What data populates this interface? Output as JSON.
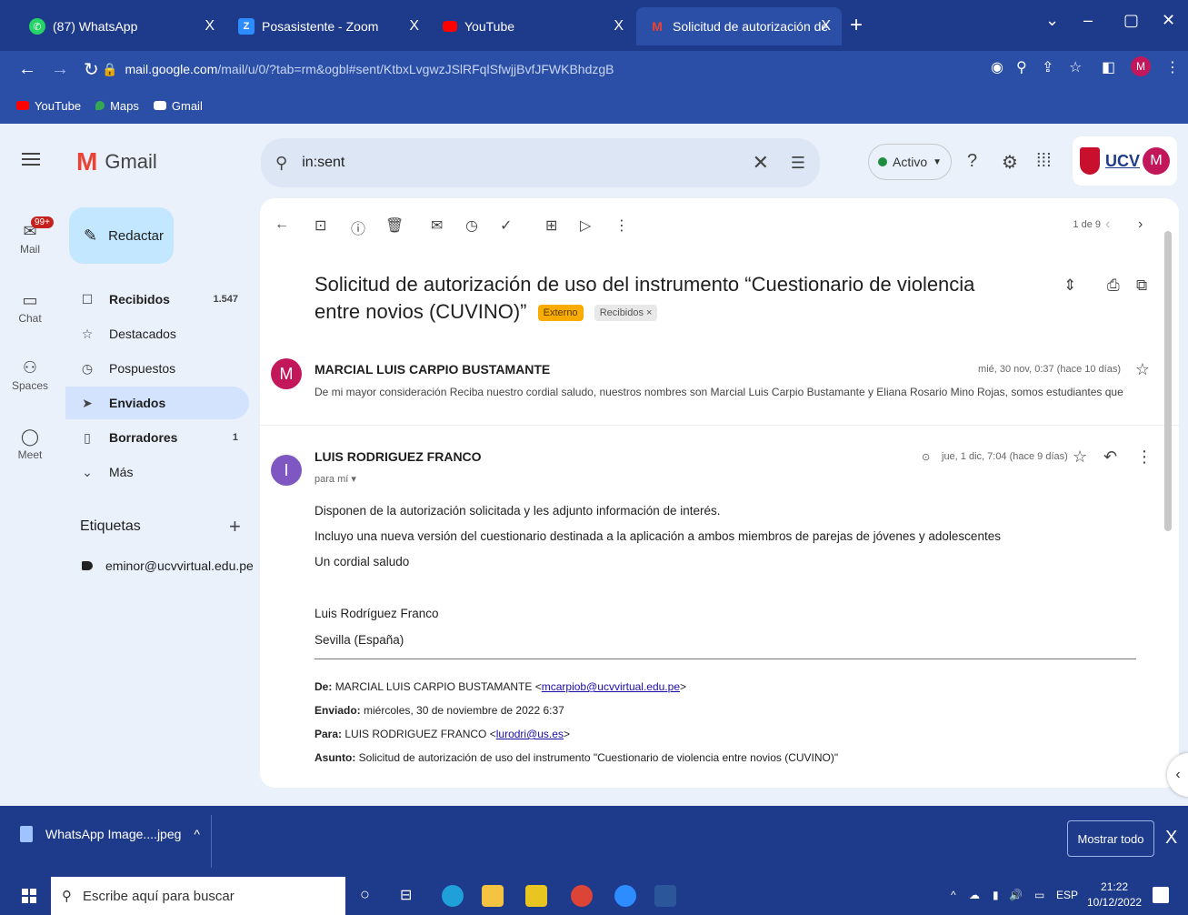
{
  "browser": {
    "tabs": [
      {
        "label": "(87) WhatsApp",
        "icon": "whatsapp-icon",
        "close": "X"
      },
      {
        "label": "Posasistente - Zoom",
        "icon": "zoom-icon",
        "close": "X"
      },
      {
        "label": "YouTube",
        "icon": "youtube-icon",
        "close": "X"
      },
      {
        "label": "Solicitud de autorización de uso",
        "icon": "gmail-icon",
        "close": "X"
      }
    ],
    "new_tab": "+",
    "url_host": "mail.google.com",
    "url_path": "/mail/u/0/?tab=rm&ogbl#sent/KtbxLvgwzJSlRFqlSfwjjBvfJFWKBhdzgB",
    "profile_initial": "M",
    "bookmarks": [
      "YouTube",
      "Maps",
      "Gmail"
    ]
  },
  "gmail": {
    "logo_text": "Gmail",
    "search_value": "in:sent",
    "status": "Activo",
    "ucv_logo": "UCV",
    "avatar_initial": "M"
  },
  "rail": {
    "mail": "Mail",
    "mail_badge": "99+",
    "chat": "Chat",
    "spaces": "Spaces",
    "meet": "Meet"
  },
  "nav": {
    "compose": "Redactar",
    "items": [
      {
        "label": "Recibidos",
        "count": "1.547"
      },
      {
        "label": "Destacados",
        "count": ""
      },
      {
        "label": "Pospuestos",
        "count": ""
      },
      {
        "label": "Enviados",
        "count": ""
      },
      {
        "label": "Borradores",
        "count": "1"
      },
      {
        "label": "Más",
        "count": ""
      }
    ],
    "labels_header": "Etiquetas",
    "labels_add": "+",
    "label_items": [
      "eminor@ucvvirtual.edu.pe"
    ]
  },
  "thread": {
    "pager": "1 de 9",
    "subject": "Solicitud de autorización de uso del instrumento “Cuestionario de violencia entre novios (CUVINO)”",
    "chip_external": "Externo",
    "chip_inbox": "Recibidos ×",
    "message1": {
      "avatar": "M",
      "sender": "MARCIAL LUIS CARPIO BUSTAMANTE",
      "date": "mié, 30 nov, 0:37 (hace 10 días)",
      "snippet": "De mi mayor consideración Reciba nuestro cordial saludo, nuestros nombres son Marcial Luis Carpio Bustamante y Eliana Rosario Mino Rojas, somos estudiantes que"
    },
    "message2": {
      "avatar": "I",
      "sender": "LUIS RODRIGUEZ FRANCO",
      "to": "para mí ▾",
      "date": "jue, 1 dic, 7:04 (hace 9 días)",
      "body": [
        "Disponen de la autorización solicitada y les adjunto información de interés.",
        "Incluyo una nueva versión del cuestionario destinada a la aplicación a ambos miembros de parejas de jóvenes y adolescentes",
        "Un cordial saludo",
        "Luis Rodríguez Franco",
        "Sevilla (España)"
      ],
      "quote": {
        "from_label": "De:",
        "from_value": "MARCIAL LUIS CARPIO BUSTAMANTE <",
        "from_email": "mcarpiob@ucvvirtual.edu.pe",
        "sent_label": "Enviado:",
        "sent_value": "miércoles, 30 de noviembre de 2022 6:37",
        "to_label": "Para:",
        "to_value": "LUIS RODRIGUEZ FRANCO <",
        "to_email": "lurodri@us.es",
        "subject_label": "Asunto:",
        "subject_value": "Solicitud de autorización de uso del instrumento \"Cuestionario de violencia entre novios (CUVINO)\""
      }
    }
  },
  "downloads": {
    "file": "WhatsApp Image....jpeg",
    "caret": "^",
    "show_all": "Mostrar todo",
    "close": "X"
  },
  "taskbar": {
    "search_placeholder": "Escribe aquí para buscar",
    "lang": "ESP",
    "time": "21:22",
    "date": "10/12/2022"
  },
  "colors": {
    "chrome": "#1e3a8a",
    "chrome_light": "#2b4fa6",
    "gmail_bg": "#eaf1fb",
    "compose": "#c2e7ff",
    "active_nav": "#d3e3fd",
    "avatar_m": "#c2185b",
    "avatar_i": "#7e57c2",
    "chip_external": "#f9ab00"
  }
}
